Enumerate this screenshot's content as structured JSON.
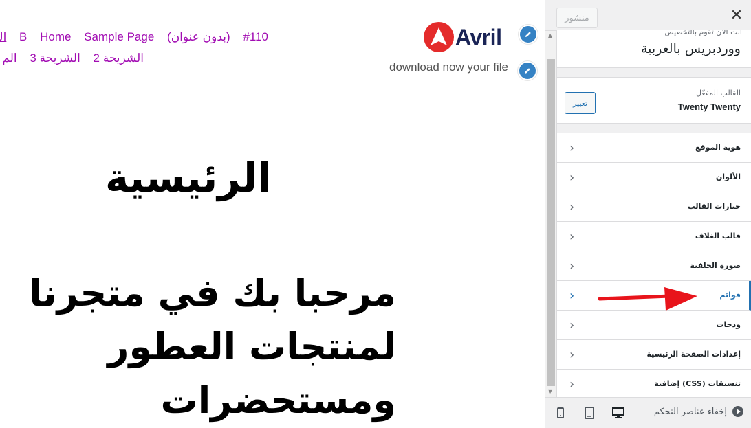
{
  "preview": {
    "nav_row_1": [
      "#110",
      "(بدون عنوان)",
      "B",
      "Home",
      "Sample Page",
      "الر"
    ],
    "nav_row_2": [
      "الشريحة 2",
      "الشريحة 3",
      "الم"
    ],
    "logo_text": "Avril",
    "tagline": "download now your file",
    "page_title": "الرئيسية",
    "welcome_heading": "مرحبا بك في متجرنا لمنتجات العطور ومستحضرات"
  },
  "panel": {
    "close_label": "✕",
    "publish_label": "منشور",
    "site_info_sub": "أنت الآن تقوم بالتخصيص",
    "site_title": "ووردبريس بالعربية",
    "theme_label": "القالب المفعّل",
    "theme_name": "Twenty Twenty",
    "change_label": "تغيير",
    "sections": [
      {
        "label": "هوية الموقع"
      },
      {
        "label": "الألوان"
      },
      {
        "label": "خيارات القالب"
      },
      {
        "label": "قالب الغلاف"
      },
      {
        "label": "صورة الخلفية"
      },
      {
        "label": "قوائم"
      },
      {
        "label": "ودجات"
      },
      {
        "label": "إعدادات الصفحة الرئيسية"
      },
      {
        "label": "تنسيقات (CSS) إضافية"
      }
    ],
    "active_section": "قوائم",
    "footer": {
      "hide_controls": "إخفاء عناصر التحكم"
    }
  },
  "colors": {
    "accent": "#2271b1",
    "nav_link": "#a20db3",
    "logo_red": "#e42b2b",
    "logo_navy": "#1a2456",
    "arrow": "#e8141b"
  }
}
